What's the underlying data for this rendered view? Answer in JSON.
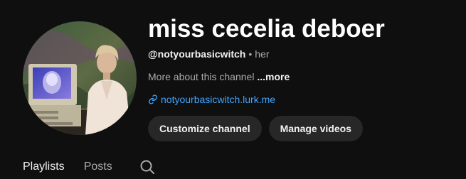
{
  "channel": {
    "name": "miss cecelia deboer",
    "handle": "@notyourbasicwitch",
    "separator": "•",
    "pronouns": "her",
    "about_text": "More about this channel",
    "about_more": "...more",
    "link_text": "notyourbasicwitch.lurk.me",
    "avatar_icon": "avatar"
  },
  "buttons": {
    "customize": "Customize channel",
    "manage": "Manage videos"
  },
  "tabs": [
    {
      "label": "Playlists",
      "active": true
    },
    {
      "label": "Posts",
      "active": false
    }
  ],
  "icons": {
    "link": "link-icon",
    "search": "search-icon"
  },
  "colors": {
    "background": "#0f0f0f",
    "button_bg": "#272727",
    "link": "#3ea6ff",
    "secondary_text": "#aaaaaa"
  }
}
